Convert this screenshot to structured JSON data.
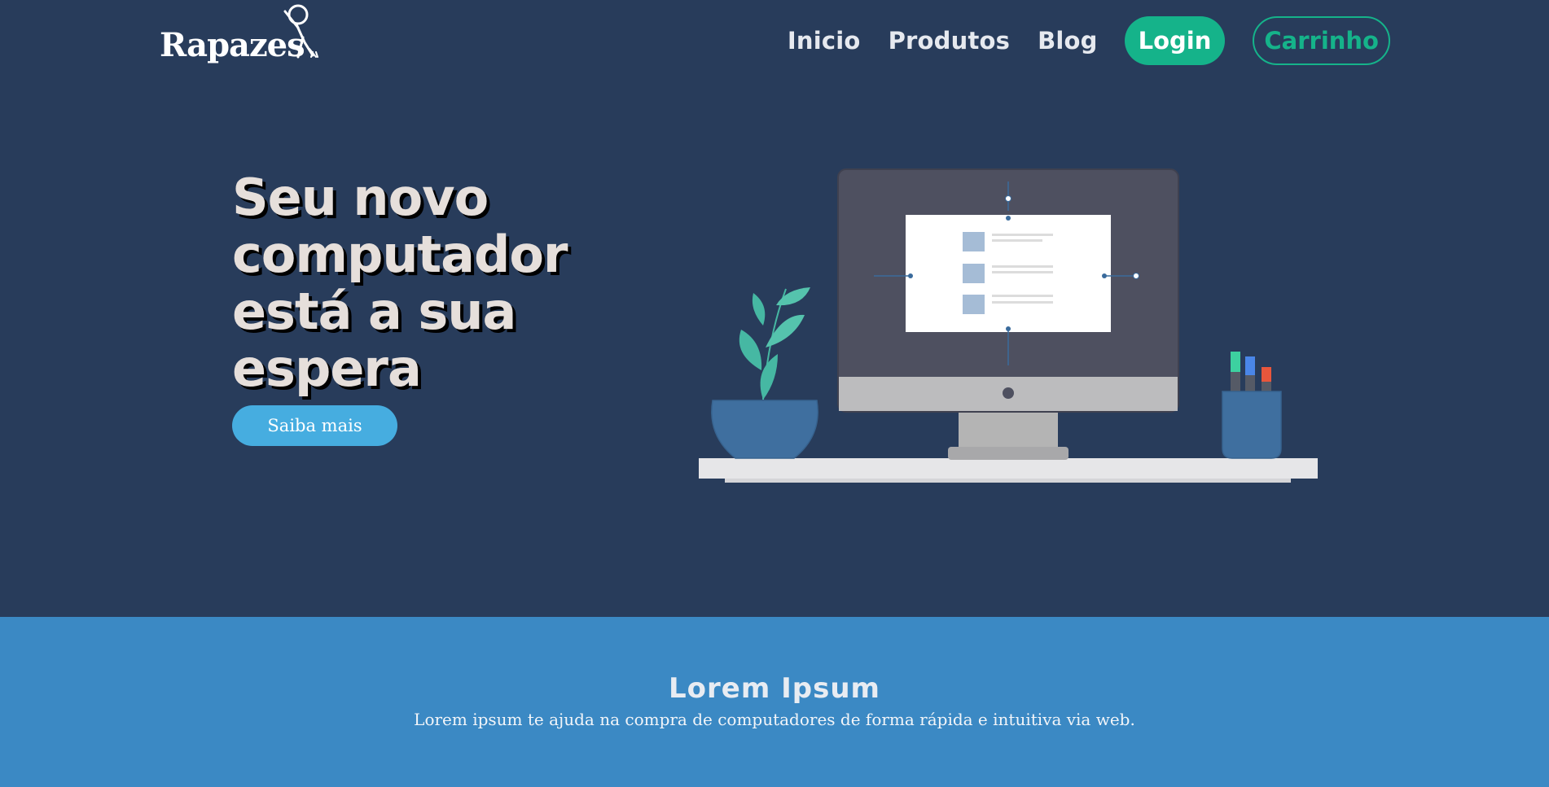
{
  "header": {
    "logo_text": "Rapazes",
    "nav": [
      "Inicio",
      "Produtos",
      "Blog"
    ],
    "login_label": "Login",
    "cart_label": "Carrinho"
  },
  "hero": {
    "title": "Seu novo computador está a sua espera",
    "cta_label": "Saiba mais"
  },
  "about": {
    "title": "Lorem Ipsum",
    "text": "Lorem ipsum te ajuda na compra de computadores de forma rápida e intuitiva via web."
  },
  "colors": {
    "background": "#283c5b",
    "accent_green": "#15b38a",
    "cta_blue": "#46ade0",
    "section_blue": "#3b89c4"
  },
  "icons": {
    "logo_figure": "waving-person-icon",
    "illustration": "desktop-computer-illustration"
  }
}
